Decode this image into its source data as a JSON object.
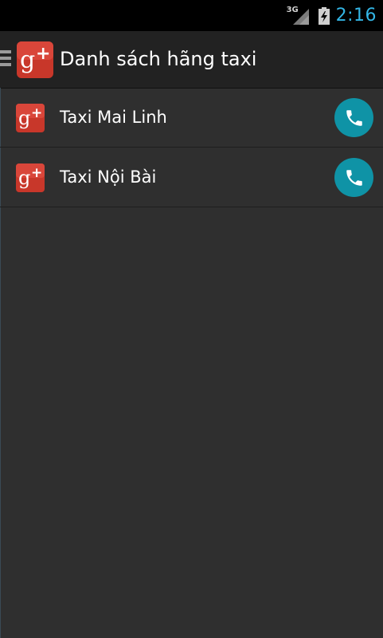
{
  "status_bar": {
    "network_type": "3G",
    "time": "2:16",
    "clock_color": "#33b5e5",
    "icons": [
      "signal-icon",
      "battery-charging-icon"
    ]
  },
  "action_bar": {
    "title": "Danh sách hãng taxi",
    "logo_icon": "google-plus-icon",
    "drawer_icon": "drawer-indicator-icon"
  },
  "taxi_list": {
    "items": [
      {
        "name": "Taxi Mai Linh",
        "icon": "google-plus-icon",
        "action_icon": "phone-icon"
      },
      {
        "name": "Taxi Nội Bài",
        "icon": "google-plus-icon",
        "action_icon": "phone-icon"
      }
    ]
  },
  "colors": {
    "background": "#2f2f2f",
    "action_bar": "#222222",
    "status_bar": "#000000",
    "call_button": "#0f93a6",
    "logo_red": "#c8372a"
  }
}
